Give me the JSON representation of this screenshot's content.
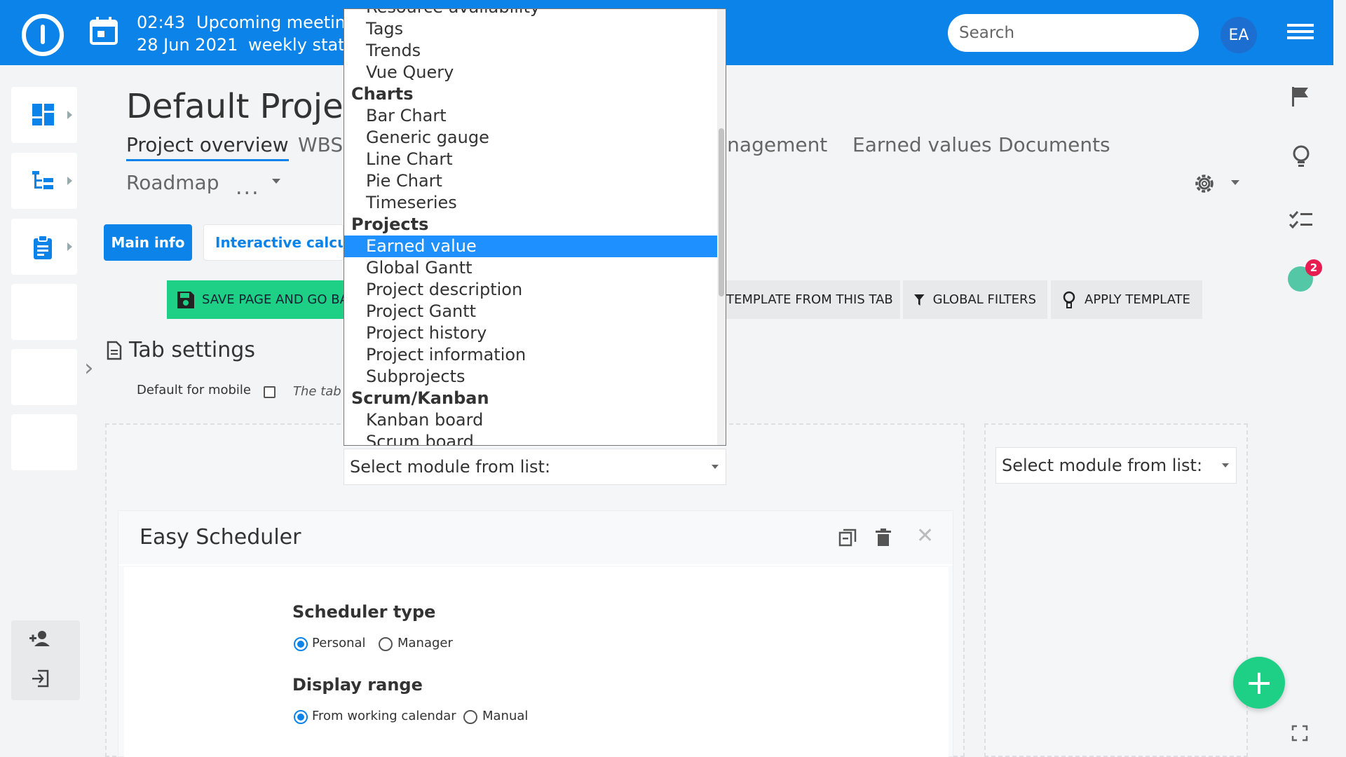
{
  "header": {
    "meeting_time": "02:43",
    "meeting_date": "28 Jun 2021",
    "meeting_title": "Upcoming meeting",
    "meeting_sub": "weekly statu",
    "search_placeholder": "Search",
    "avatar_initials": "EA"
  },
  "page": {
    "title": "Default Projec",
    "tabs": [
      "Project overview",
      "WBS",
      "anagement",
      "Earned values",
      "Documents"
    ],
    "tab_roadmap": "Roadmap",
    "tab_more": "...",
    "btn_main_info": "Main info",
    "btn_interactive": "Interactive calculat",
    "btn_save": "SAVE PAGE AND GO BAC",
    "btn_template": "TEMPLATE FROM THIS TAB",
    "btn_filters": "GLOBAL FILTERS",
    "btn_apply": "APPLY TEMPLATE",
    "tab_settings_title": "Tab settings",
    "mobile_label": "Default for mobile",
    "mobile_note": "The tab w",
    "select_placeholder": "Select module from list:"
  },
  "scheduler": {
    "title": "Easy Scheduler",
    "type_label": "Scheduler type",
    "type_options": [
      "Personal",
      "Manager"
    ],
    "range_label": "Display range",
    "range_options": [
      "From working calendar",
      "Manual"
    ]
  },
  "timer_badge": "2",
  "dropdown": {
    "groups": [
      {
        "label": "",
        "items": [
          "Resource availability",
          "Tags",
          "Trends",
          "Vue Query"
        ]
      },
      {
        "label": "Charts",
        "items": [
          "Bar Chart",
          "Generic gauge",
          "Line Chart",
          "Pie Chart",
          "Timeseries"
        ]
      },
      {
        "label": "Projects",
        "items": [
          "Earned value",
          "Global Gantt",
          "Project description",
          "Project Gantt",
          "Project history",
          "Project information",
          "Subprojects"
        ]
      },
      {
        "label": "Scrum/Kanban",
        "items": [
          "Kanban board",
          "Scrum board"
        ]
      }
    ],
    "selected": "Earned value"
  },
  "colors": {
    "brand": "#0c83e8",
    "success": "#1ed086",
    "badge": "#e71d52"
  }
}
